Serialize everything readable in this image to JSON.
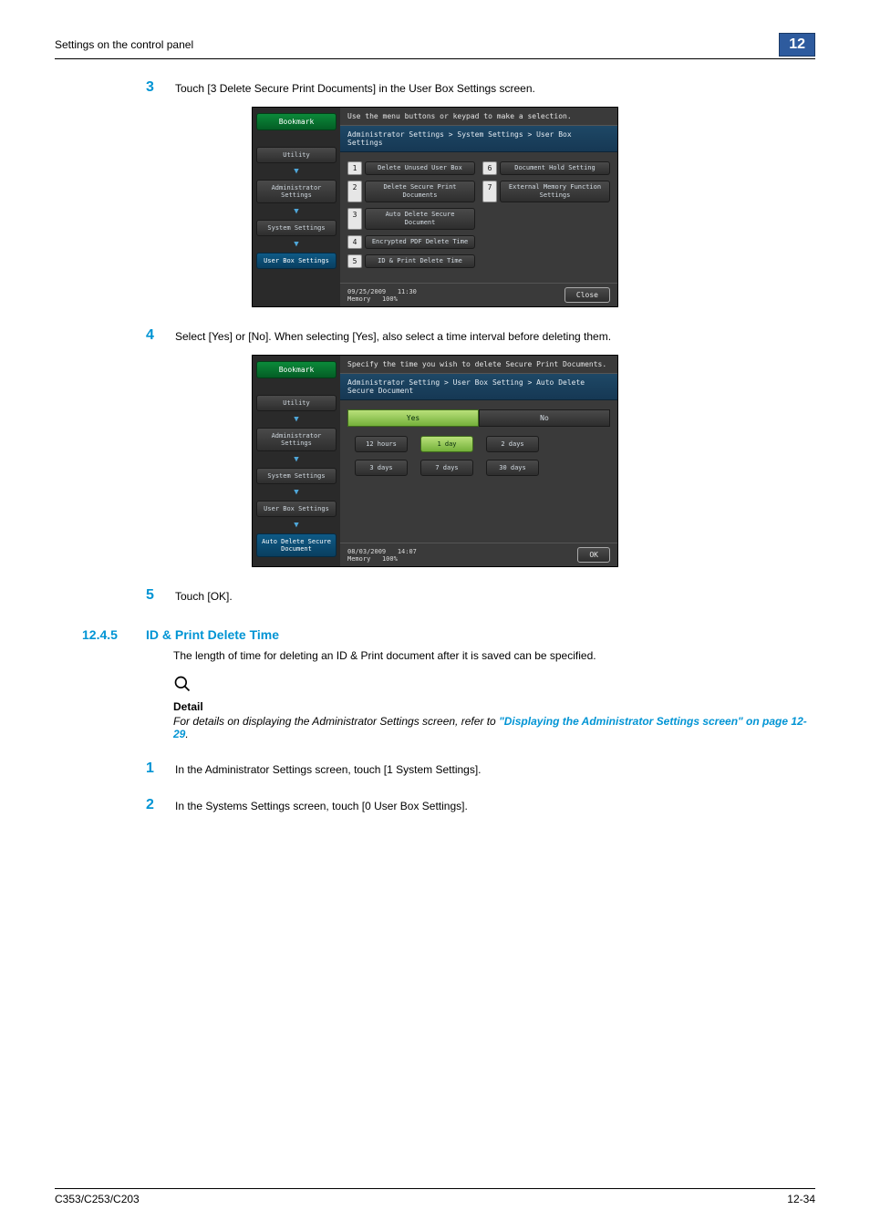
{
  "header": {
    "title": "Settings on the control panel",
    "chapter": "12"
  },
  "step3": {
    "num": "3",
    "text": "Touch [3 Delete Secure Print Documents] in the User Box Settings screen."
  },
  "shot1": {
    "top": "Use the menu buttons or keypad to make a selection.",
    "crumb": "Administrator Settings > System Settings > User Box Settings",
    "bookmark": "Bookmark",
    "nav": [
      "Utility",
      "Administrator Settings",
      "System Settings",
      "User Box Settings"
    ],
    "left": [
      {
        "n": "1",
        "label": "Delete Unused User Box"
      },
      {
        "n": "2",
        "label": "Delete Secure\nPrint Documents"
      },
      {
        "n": "3",
        "label": "Auto Delete Secure Document"
      },
      {
        "n": "4",
        "label": "Encrypted PDF Delete Time"
      },
      {
        "n": "5",
        "label": "ID & Print Delete Time"
      }
    ],
    "right": [
      {
        "n": "6",
        "label": "Document Hold Setting"
      },
      {
        "n": "7",
        "label": "External Memory\nFunction Settings"
      }
    ],
    "footer": {
      "date": "09/25/2009",
      "time": "11:30",
      "mem": "Memory",
      "pct": "100%",
      "btn": "Close"
    }
  },
  "step4": {
    "num": "4",
    "text": "Select [Yes] or [No]. When selecting [Yes], also select a time interval before deleting them."
  },
  "shot2": {
    "top": "Specify the time you wish to delete Secure Print Documents.",
    "crumb": "Administrator Setting > User Box Setting > Auto Delete Secure Document",
    "bookmark": "Bookmark",
    "nav": [
      "Utility",
      "Administrator Settings",
      "System Settings",
      "User Box Settings",
      "Auto Delete Secure Document"
    ],
    "tabs": {
      "yes": "Yes",
      "no": "No"
    },
    "options": [
      "12 hours",
      "1 day",
      "2 days",
      "3 days",
      "7 days",
      "30 days"
    ],
    "selected": "1 day",
    "footer": {
      "date": "08/03/2009",
      "time": "14:07",
      "mem": "Memory",
      "pct": "100%",
      "btn": "OK"
    }
  },
  "step5": {
    "num": "5",
    "text": "Touch [OK]."
  },
  "section": {
    "num": "12.4.5",
    "title": "ID & Print Delete Time",
    "para": "The length of time for deleting an ID & Print document after it is saved can be specified.",
    "detail_label": "Detail",
    "detail_pre": "For details on displaying the Administrator Settings screen, refer to ",
    "detail_link": "\"Displaying the Administrator Settings screen\" on page 12-29",
    "detail_post": "."
  },
  "stepA": {
    "num": "1",
    "text": "In the Administrator Settings screen, touch [1 System Settings]."
  },
  "stepB": {
    "num": "2",
    "text": "In the Systems Settings screen, touch [0 User Box Settings]."
  },
  "footer": {
    "left": "C353/C253/C203",
    "right": "12-34"
  }
}
